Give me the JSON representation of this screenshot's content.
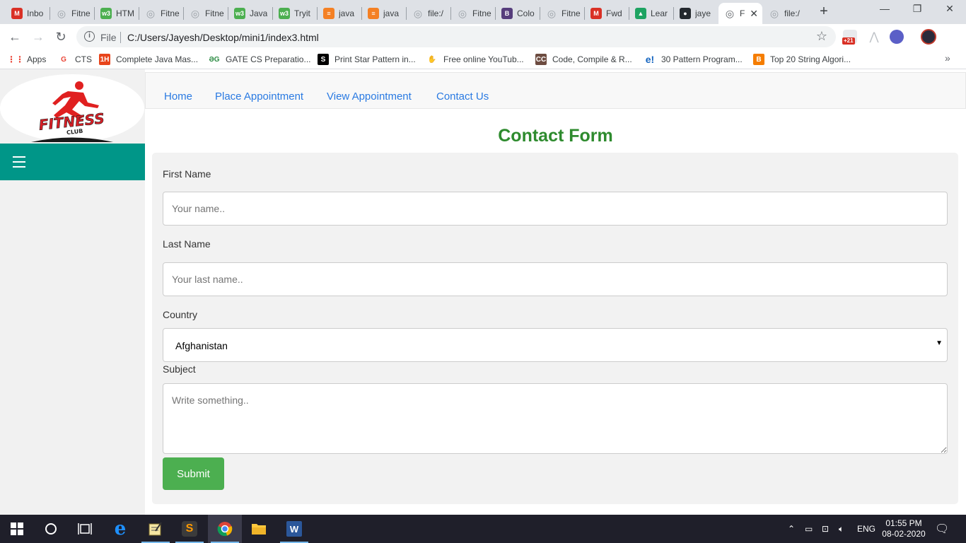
{
  "browser": {
    "tabs": [
      {
        "label": "Inbo",
        "icon": "gmail-icon",
        "color": "#d93025",
        "glyph": "M"
      },
      {
        "label": "Fitne",
        "icon": "globe-icon",
        "color": "#9aa0a6",
        "glyph": "◎"
      },
      {
        "label": "HTM",
        "icon": "w3schools-icon",
        "color": "#4caf50",
        "glyph": "w3"
      },
      {
        "label": "Fitne",
        "icon": "globe-icon",
        "color": "#9aa0a6",
        "glyph": "◎"
      },
      {
        "label": "Fitne",
        "icon": "globe-icon",
        "color": "#9aa0a6",
        "glyph": "◎"
      },
      {
        "label": "Java",
        "icon": "w3schools-icon",
        "color": "#4caf50",
        "glyph": "w3"
      },
      {
        "label": "Tryit",
        "icon": "w3schools-icon",
        "color": "#4caf50",
        "glyph": "w3"
      },
      {
        "label": "java",
        "icon": "stackoverflow-icon",
        "color": "#f48024",
        "glyph": "≡"
      },
      {
        "label": "java",
        "icon": "stackoverflow-icon",
        "color": "#f48024",
        "glyph": "≡"
      },
      {
        "label": "file:/",
        "icon": "globe-icon",
        "color": "#9aa0a6",
        "glyph": "◎"
      },
      {
        "label": "Fitne",
        "icon": "globe-icon",
        "color": "#9aa0a6",
        "glyph": "◎"
      },
      {
        "label": "Colo",
        "icon": "bootstrap-icon",
        "color": "#563d7c",
        "glyph": "B"
      },
      {
        "label": "Fitne",
        "icon": "globe-icon",
        "color": "#9aa0a6",
        "glyph": "◎"
      },
      {
        "label": "Fwd",
        "icon": "gmail-icon",
        "color": "#d93025",
        "glyph": "M"
      },
      {
        "label": "Lear",
        "icon": "google-drive-icon",
        "color": "#1ea362",
        "glyph": "▲"
      },
      {
        "label": "jaye",
        "icon": "github-icon",
        "color": "#24292e",
        "glyph": "●"
      },
      {
        "label": "F",
        "icon": "globe-icon",
        "color": "#5f6368",
        "glyph": "◎"
      },
      {
        "label": "file:/",
        "icon": "globe-icon",
        "color": "#9aa0a6",
        "glyph": "◎"
      }
    ],
    "scheme": "File",
    "url": "C:/Users/Jayesh/Desktop/mini1/index3.html",
    "extension_badge": "+21",
    "bookmarks": [
      {
        "label": "Apps",
        "icon": "apps-grid-icon",
        "color": "#ea4335",
        "glyph": "⋮⋮"
      },
      {
        "label": "CTS",
        "icon": "google-icon",
        "color": "#ea4335",
        "glyph": "G"
      },
      {
        "label": "Complete Java Mas...",
        "icon": "1h-icon",
        "color": "#e8451c",
        "glyph": "1H"
      },
      {
        "label": "GATE CS Preparatio...",
        "icon": "gfg-icon",
        "color": "#2f8d46",
        "glyph": "ƏG"
      },
      {
        "label": "Print Star Pattern in...",
        "icon": "s-icon",
        "color": "#000000",
        "glyph": "S"
      },
      {
        "label": "Free online YouTub...",
        "icon": "hand-icon",
        "color": "#c2185b",
        "glyph": "✋"
      },
      {
        "label": "Code, Compile & R...",
        "icon": "cc-icon",
        "color": "#6d4c41",
        "glyph": "CC"
      },
      {
        "label": "30 Pattern Program...",
        "icon": "edureka-icon",
        "color": "#1565c0",
        "glyph": "e!"
      },
      {
        "label": "Top 20 String Algori...",
        "icon": "blogger-icon",
        "color": "#f57d00",
        "glyph": "B"
      }
    ]
  },
  "site": {
    "logo_text": "FITNESS",
    "logo_sub": "CLUB",
    "nav": [
      "Home",
      "Place Appointment",
      "View Appointment",
      "Contact Us"
    ]
  },
  "form": {
    "title": "Contact Form",
    "first_name_label": "First Name",
    "first_name_placeholder": "Your name..",
    "last_name_label": "Last Name",
    "last_name_placeholder": "Your last name..",
    "country_label": "Country",
    "country_value": "Afghanistan",
    "subject_label": "Subject",
    "subject_placeholder": "Write something..",
    "submit_label": "Submit"
  },
  "taskbar": {
    "language": "ENG",
    "time": "01:55 PM",
    "date": "08-02-2020"
  }
}
